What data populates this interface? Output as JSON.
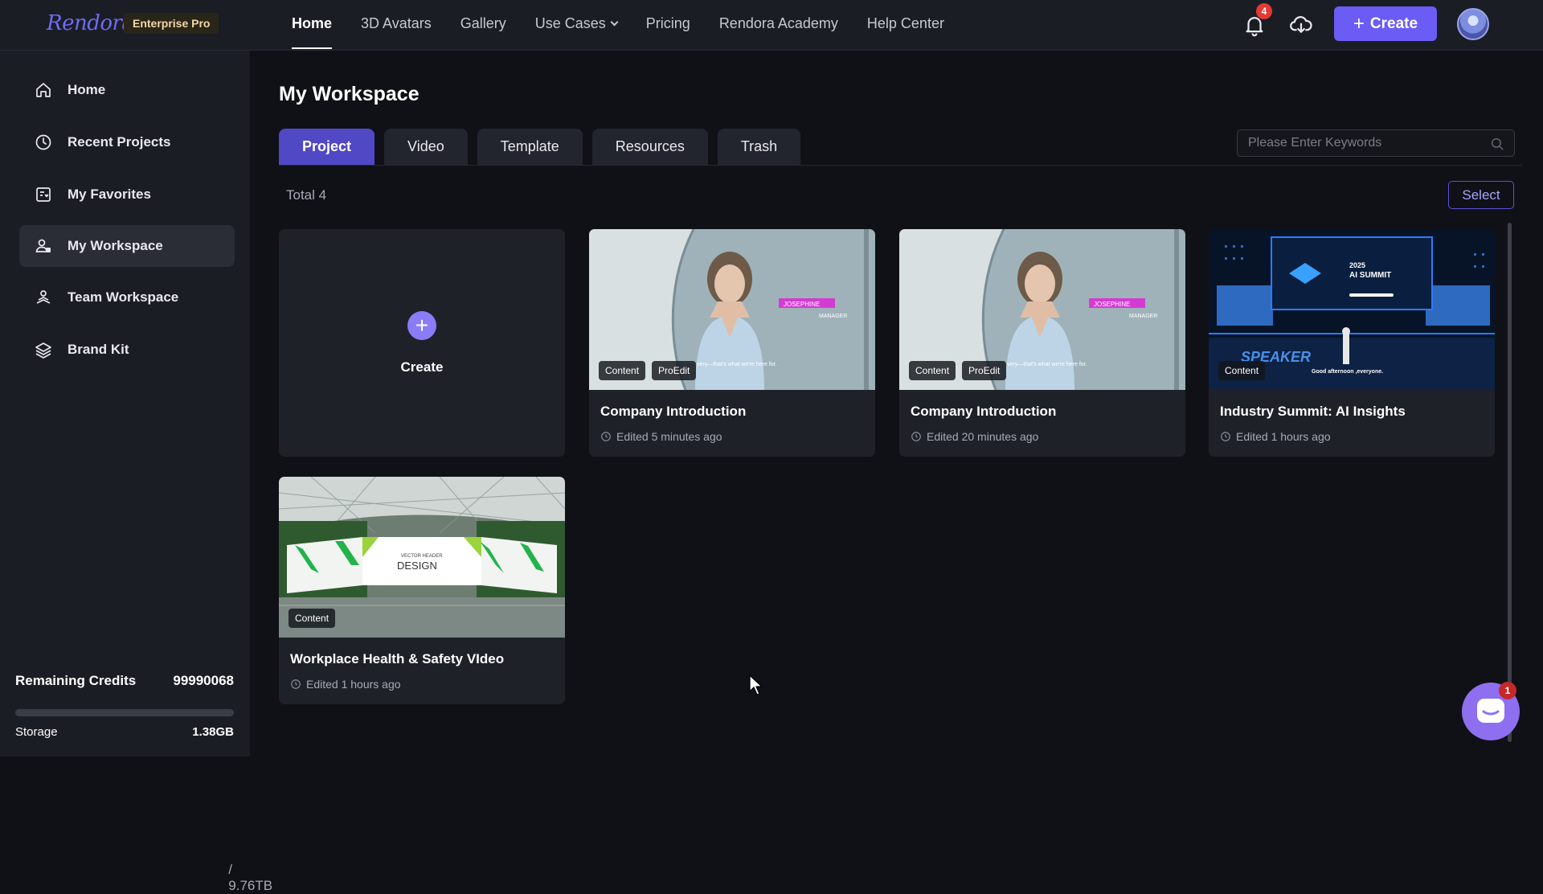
{
  "app": {
    "logo_text": "Rendora",
    "plan": "Enterprise Pro"
  },
  "nav": {
    "items": [
      {
        "label": "Home",
        "active": true
      },
      {
        "label": "3D Avatars"
      },
      {
        "label": "Gallery"
      },
      {
        "label": "Use Cases",
        "has_dropdown": true
      },
      {
        "label": "Pricing"
      },
      {
        "label": "Rendora Academy"
      },
      {
        "label": "Help Center"
      }
    ]
  },
  "header": {
    "notification_count": "4",
    "create_label": "Create",
    "create_icon": "plus-icon"
  },
  "sidebar": {
    "items": [
      {
        "label": "Home",
        "icon": "home-icon"
      },
      {
        "label": "Recent Projects",
        "icon": "clock-icon"
      },
      {
        "label": "My Favorites",
        "icon": "favorites-icon"
      },
      {
        "label": "My Workspace",
        "icon": "workspace-icon",
        "active": true
      },
      {
        "label": "Team Workspace",
        "icon": "team-icon"
      },
      {
        "label": "Brand Kit",
        "icon": "layers-icon"
      }
    ],
    "credits_label": "Remaining Credits",
    "credits_value": "99990068",
    "storage_label": "Storage",
    "storage_used": "1.38GB",
    "storage_total": " / 9.76TB",
    "storage_fraction": 0.0001
  },
  "main": {
    "title": "My Workspace",
    "tabs": [
      {
        "label": "Project",
        "active": true
      },
      {
        "label": "Video"
      },
      {
        "label": "Template"
      },
      {
        "label": "Resources"
      },
      {
        "label": "Trash"
      }
    ],
    "search_placeholder": "Please Enter Keywords",
    "total": "Total 4",
    "select_label": "Select",
    "create_card_label": "Create",
    "projects": [
      {
        "title": "Company Introduction",
        "time": "Edited 5 minutes ago",
        "badges": [
          "Content",
          "ProEdit"
        ],
        "thumb": "avatar-presenter"
      },
      {
        "title": "Company Introduction",
        "time": "Edited 20 minutes ago",
        "badges": [
          "Content",
          "ProEdit"
        ],
        "thumb": "avatar-presenter"
      },
      {
        "title": "Industry Summit: AI Insights",
        "time": "Edited 1 hours ago",
        "badges": [
          "Content"
        ],
        "thumb": "summit-stage"
      },
      {
        "title": "Workplace Health & Safety VIdeo",
        "time": "Edited 1 hours ago",
        "badges": [
          "Content"
        ],
        "thumb": "dome-stage"
      }
    ]
  },
  "thumb_text": {
    "name_tag": "JOSEPHINE",
    "role_tag": "MANAGER",
    "caption": "very—that's what we're here for.",
    "summit_year": "2025",
    "summit_title": "AI SUMMIT",
    "speaker": "SPEAKER",
    "greeting": "Good afternoon ,everyone.",
    "banner_small": "VECTOR HEADER",
    "banner_big": "DESIGN"
  },
  "chat": {
    "unread": "1"
  },
  "colors": {
    "accent": "#6b5cf6",
    "active_tab": "#5048c4",
    "badge_red": "#e53935"
  }
}
